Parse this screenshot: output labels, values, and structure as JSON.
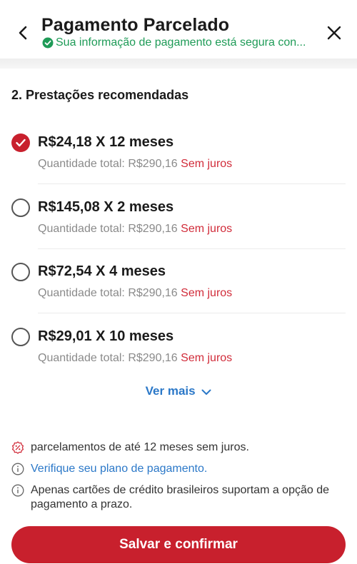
{
  "header": {
    "title": "Pagamento Parcelado",
    "secure_text": "Sua informação de pagamento está segura con..."
  },
  "section": {
    "title": "2. Prestações recomendadas"
  },
  "options": [
    {
      "label": "R$24,18 X 12 meses",
      "total": "Quantidade total: R$290,16",
      "tag": "Sem juros",
      "selected": true
    },
    {
      "label": "R$145,08 X 2 meses",
      "total": "Quantidade total: R$290,16",
      "tag": "Sem juros",
      "selected": false
    },
    {
      "label": "R$72,54 X 4 meses",
      "total": "Quantidade total: R$290,16",
      "tag": "Sem juros",
      "selected": false
    },
    {
      "label": "R$29,01 X 10 meses",
      "total": "Quantidade total: R$290,16",
      "tag": "Sem juros",
      "selected": false
    }
  ],
  "ver_mais": "Ver mais",
  "info": {
    "promo": "parcelamentos de até 12 meses sem juros.",
    "verify_link": "Verifique seu plano de pagamento.",
    "notice": "Apenas cartões de crédito brasileiros suportam a opção de pagamento a prazo."
  },
  "confirm_button": "Salvar e confirmar",
  "colors": {
    "accent": "#c8202d",
    "secure_green": "#1e9b57",
    "link_blue": "#2b78c8",
    "muted": "#8a8a8a"
  },
  "icons": {
    "back": "back-arrow-icon",
    "close": "close-icon",
    "secure": "shield-check-icon",
    "promo": "discount-badge-icon",
    "info": "info-icon",
    "more": "chevron-down-icon"
  }
}
